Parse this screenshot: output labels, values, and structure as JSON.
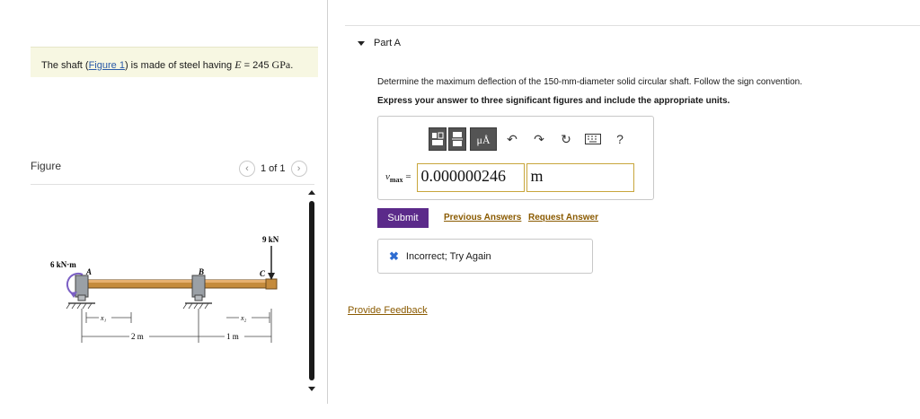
{
  "problem": {
    "prefix": "The shaft (",
    "figure_link": "Figure 1",
    "middle": ") is made of steel having ",
    "var": "E",
    "equals": " = 245 ",
    "unit": "GPa",
    "suffix": "."
  },
  "figure": {
    "title": "Figure",
    "pager": "1 of 1",
    "labels": {
      "moment": "6 kN·m",
      "force": "9 kN",
      "A": "A",
      "B": "B",
      "C": "C",
      "x1": "x₁",
      "x2": "x₂",
      "dim1": "2 m",
      "dim2": "1 m"
    }
  },
  "part": {
    "title": "Part A",
    "question": "Determine the maximum deflection of the 150-mm-diameter solid circular shaft. Follow the sign convention.",
    "instruction": "Express your answer to three significant figures and include the appropriate units."
  },
  "answer": {
    "label_var": "v",
    "label_sub": "max",
    "label_eq": " =",
    "value": "0.000000246",
    "unit": "m"
  },
  "toolbar": {
    "units_label": "μÅ",
    "undo_icon": "undo-icon",
    "redo_icon": "redo-icon",
    "reset_icon": "reset-icon",
    "keyboard_icon": "keyboard-icon",
    "help_label": "?"
  },
  "actions": {
    "submit": "Submit",
    "previous_answers": "Previous Answers",
    "request_answer": "Request Answer",
    "feedback_text": "Incorrect; Try Again",
    "provide_feedback": "Provide Feedback"
  },
  "colors": {
    "submit_bg": "#5b2a8a",
    "link": "#8a5a00",
    "incorrect_icon": "#2e6cd1",
    "input_border": "#c8a63c"
  }
}
